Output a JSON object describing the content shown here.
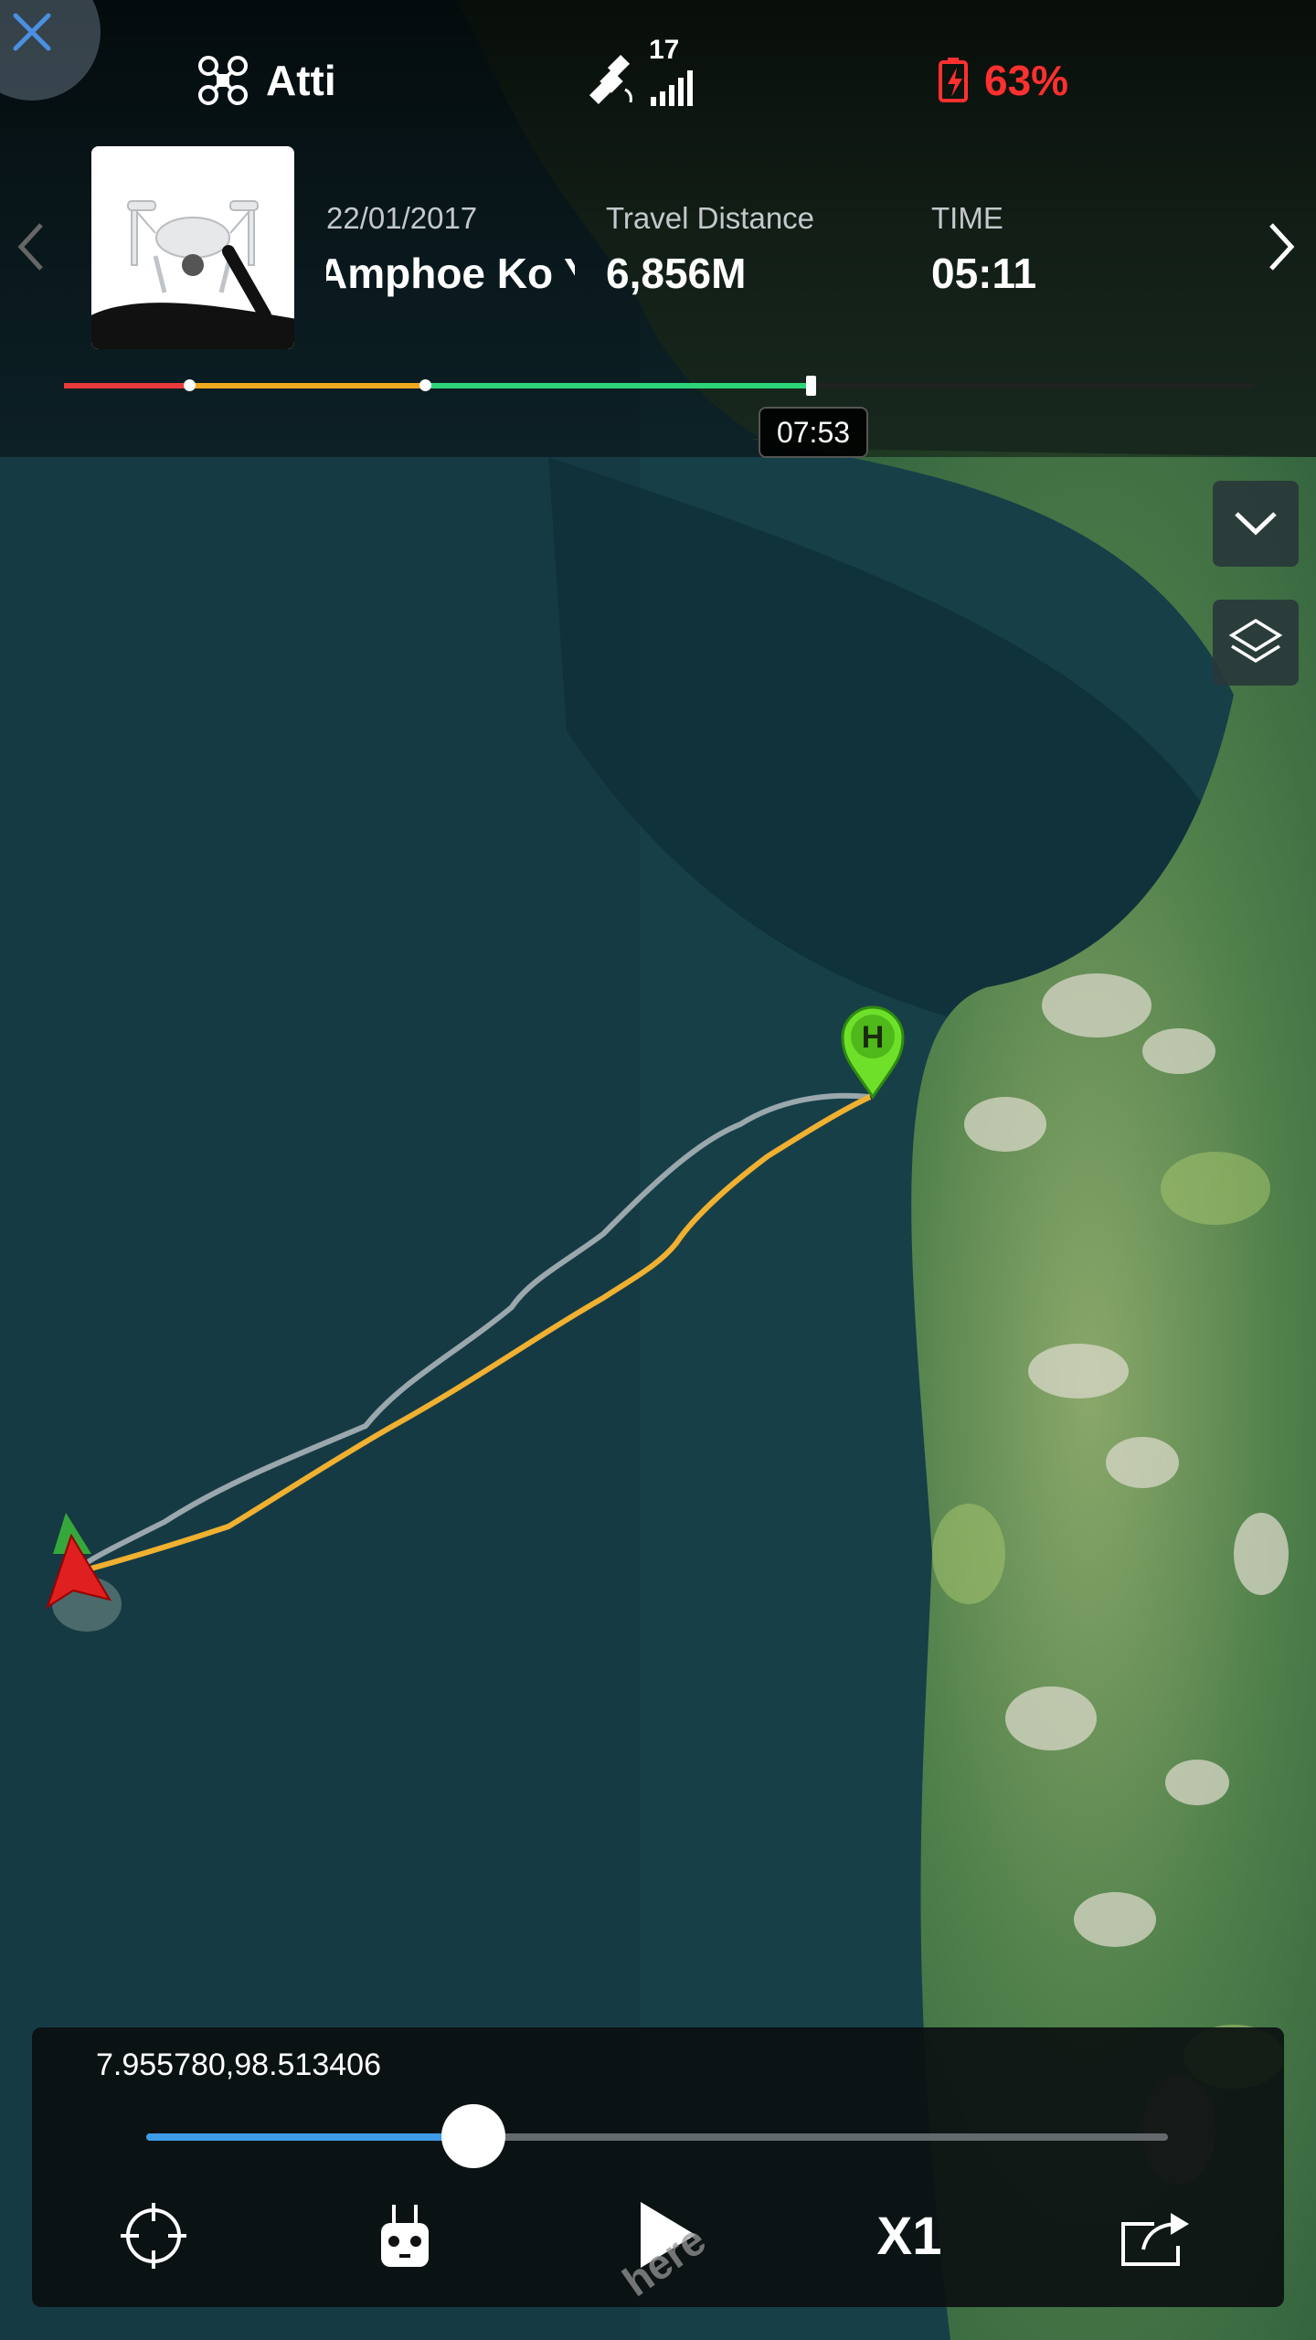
{
  "status_bar": {
    "flight_mode": "Atti",
    "satellite_count": "17",
    "battery": "63%",
    "icons": [
      "drone-icon",
      "satellite-icon",
      "signal-bars-icon",
      "battery-charging-icon"
    ]
  },
  "flight_record": {
    "date": "22/01/2017",
    "location": "Amphoe Ko Y",
    "travel_distance_label": "Travel Distance",
    "travel_distance_value": "6,856M",
    "time_label": "TIME",
    "time_value": "05:11"
  },
  "timeline": {
    "current_time": "07:53",
    "segment_colors": [
      "#e83a3a",
      "#f0a81f",
      "#2ed47a"
    ]
  },
  "map": {
    "home_marker_label": "H",
    "flight_path_color": "#f0b030",
    "planned_path_color": "#9aa7ad",
    "watermark": "here"
  },
  "playback": {
    "coordinates": "7.955780,98.513406",
    "progress": 0.32,
    "speed": "X1",
    "accent_color": "#3c9ce8"
  }
}
